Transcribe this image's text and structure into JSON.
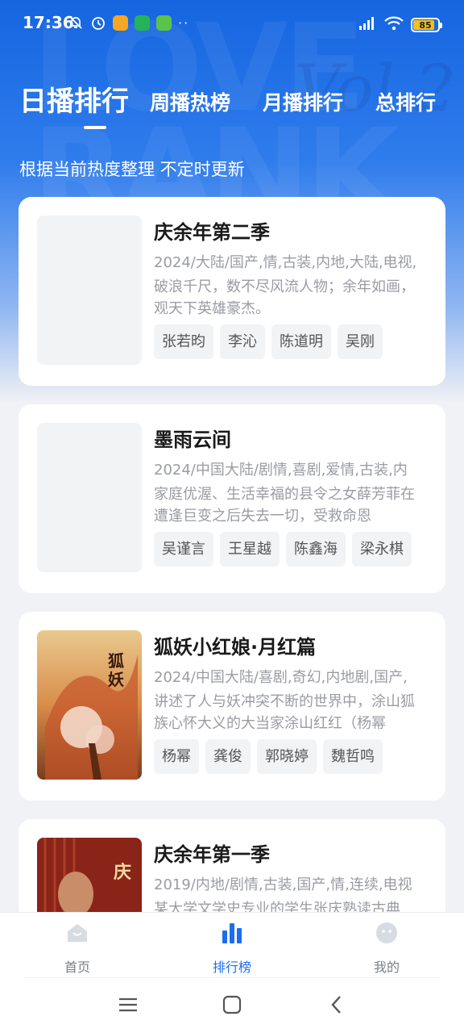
{
  "status_bar": {
    "time": "17:36",
    "battery": "85",
    "battery_level": 0.85,
    "dots": "··",
    "icons": [
      "bell-off-icon",
      "alarm-icon",
      "app-notification-icon",
      "shield-app-icon",
      "download-app-icon",
      "hd-signal-icon",
      "wifi-icon",
      "battery-icon"
    ]
  },
  "header": {
    "tabs": [
      {
        "label": "日播排行",
        "active": true
      },
      {
        "label": "周播热榜",
        "active": false
      },
      {
        "label": "月播排行",
        "active": false
      },
      {
        "label": "总排行",
        "active": false
      }
    ],
    "subtitle": "根据当前热度整理 不定时更新"
  },
  "cards": [
    {
      "title": "庆余年第二季",
      "meta": "2024/大陆/国产,情,古装,内地,大陆,电视,",
      "desc": "破浪千尺，数不尽风流人物；余年如画，观天下英雄豪杰。",
      "tags": [
        "张若昀",
        "李沁",
        "陈道明",
        "吴刚"
      ],
      "poster": "empty"
    },
    {
      "title": "墨雨云间",
      "meta": "2024/中国大陆/剧情,喜剧,爱情,古装,内",
      "desc": "家庭优渥、生活幸福的县令之女薛芳菲在遭逢巨变之后失去一切，受救命恩",
      "tags": [
        "吴谨言",
        "王星越",
        "陈鑫海",
        "梁永棋"
      ],
      "poster": "empty"
    },
    {
      "title": "狐妖小红娘·月红篇",
      "meta": "2024/中国大陆/喜剧,奇幻,内地剧,国产,",
      "desc": "讲述了人与妖冲突不断的世界中，涂山狐族心怀大义的大当家涂山红红（杨幂",
      "tags": [
        "杨幂",
        "龚俊",
        "郭晓婷",
        "魏哲鸣"
      ],
      "poster": "fox"
    },
    {
      "title": "庆余年第一季",
      "meta": "2019/内地/剧情,古装,国产,情,连续,电视",
      "desc": "某大学文学史专业的学生张庆熟读古典",
      "tags": [],
      "poster": "qyn"
    }
  ],
  "bottom_nav": {
    "items": [
      {
        "label": "首页",
        "icon": "home-icon",
        "active": false
      },
      {
        "label": "排行榜",
        "icon": "ranking-bars-icon",
        "active": true
      },
      {
        "label": "我的",
        "icon": "profile-face-icon",
        "active": false
      }
    ]
  },
  "colors": {
    "brand_blue": "#1c6ef0",
    "header_blue": "#1565e0",
    "tag_bg": "#f2f3f5",
    "muted_text": "#9a9ca3"
  },
  "system_nav": [
    "menu-icon",
    "home-square-icon",
    "back-chevron-icon"
  ]
}
